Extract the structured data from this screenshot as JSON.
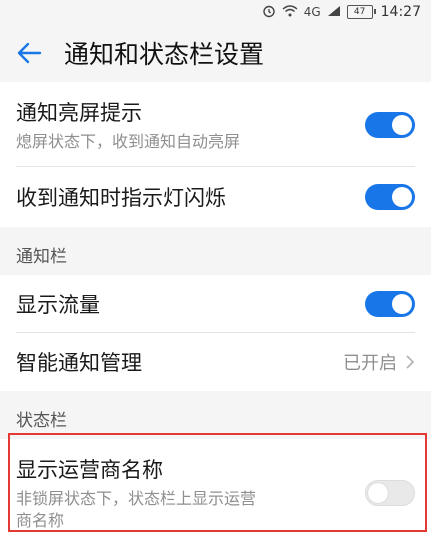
{
  "status_bar": {
    "network_label": "4G",
    "battery_level": "47",
    "time": "14:27"
  },
  "header": {
    "title": "通知和状态栏设置"
  },
  "rows": {
    "wake_screen": {
      "title": "通知亮屏提示",
      "subtitle": "熄屏状态下，收到通知自动亮屏",
      "enabled": true
    },
    "led_flash": {
      "title": "收到通知时指示灯闪烁",
      "enabled": true
    },
    "show_traffic": {
      "title": "显示流量",
      "enabled": true
    },
    "smart_notify": {
      "title": "智能通知管理",
      "value": "已开启"
    },
    "carrier_name": {
      "title": "显示运营商名称",
      "subtitle_line1": "非锁屏状态下，状态栏上显示运营",
      "subtitle_line2": "商名称",
      "enabled": false
    }
  },
  "sections": {
    "notification_bar": "通知栏",
    "status_bar": "状态栏"
  },
  "colors": {
    "accent": "#1976e8",
    "highlight": "#e53935"
  }
}
